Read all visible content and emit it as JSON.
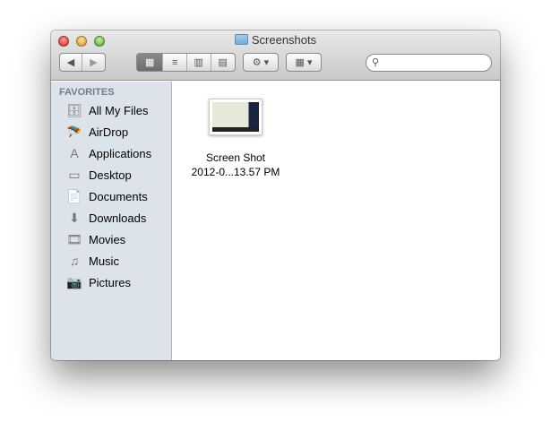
{
  "window": {
    "title": "Screenshots"
  },
  "toolbar": {
    "back": "◀",
    "forward": "▶",
    "view_icons": "▦",
    "view_list": "≡",
    "view_columns": "▥",
    "view_coverflow": "▤",
    "action": "⚙ ▾",
    "arrange": "▦ ▾",
    "search_placeholder": ""
  },
  "sidebar": {
    "header": "FAVORITES",
    "items": [
      {
        "label": "All My Files",
        "icon": "🗄"
      },
      {
        "label": "AirDrop",
        "icon": "🪂"
      },
      {
        "label": "Applications",
        "icon": "A"
      },
      {
        "label": "Desktop",
        "icon": "▭"
      },
      {
        "label": "Documents",
        "icon": "📄"
      },
      {
        "label": "Downloads",
        "icon": "⬇"
      },
      {
        "label": "Movies",
        "icon": "🎞"
      },
      {
        "label": "Music",
        "icon": "♫"
      },
      {
        "label": "Pictures",
        "icon": "📷"
      }
    ]
  },
  "files": [
    {
      "name_line1": "Screen Shot",
      "name_line2": "2012-0...13.57 PM"
    }
  ]
}
